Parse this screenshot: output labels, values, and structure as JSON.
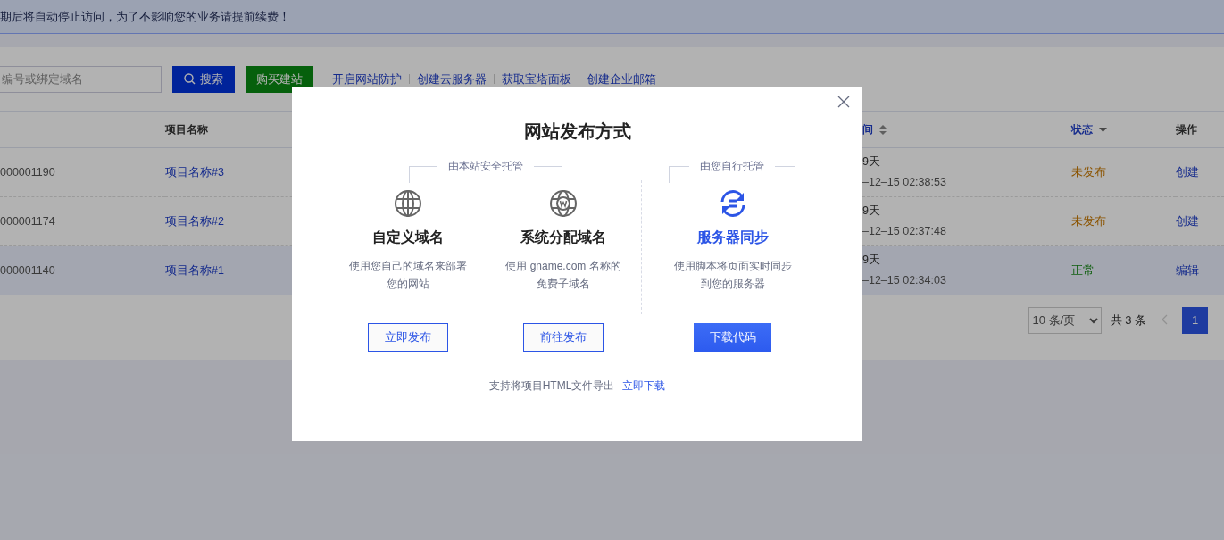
{
  "notice": "期后将自动停止访问，为了不影响您的业务请提前续费！",
  "toolbar": {
    "search": {
      "placeholder": "编号或绑定域名"
    },
    "search_button": "搜索",
    "buy_button": "购买建站",
    "links": [
      "开启网站防护",
      "创建云服务器",
      "获取宝塔面板",
      "创建企业邮箱"
    ]
  },
  "table": {
    "columns": [
      {
        "label": "项目名称",
        "kind": "plain"
      },
      {
        "label": "间",
        "kind": "sort"
      },
      {
        "label": "状态",
        "kind": "filter"
      },
      {
        "label": "操作",
        "kind": "plain"
      }
    ],
    "rows": [
      {
        "id": "000001190",
        "name": "项目名称#3",
        "days": "9天",
        "time": "–12–15 02:38:53",
        "status": "未发布",
        "kind": "pending",
        "action": "创建",
        "hovered": false
      },
      {
        "id": "000001174",
        "name": "项目名称#2",
        "days": "9天",
        "time": "–12–15 02:37:48",
        "status": "未发布",
        "kind": "pending",
        "action": "创建",
        "hovered": false
      },
      {
        "id": "000001140",
        "name": "项目名称#1",
        "days": "9天",
        "time": "–12–15 02:34:03",
        "status": "正常",
        "kind": "normal",
        "action": "编辑",
        "hovered": true
      }
    ]
  },
  "pagination": {
    "page_size": "10 条/页",
    "total": "共 3 条",
    "prev_disabled": true,
    "pages": [
      {
        "label": "1",
        "selected": true
      }
    ]
  },
  "modal": {
    "title": "网站发布方式",
    "groups": [
      {
        "label": "由本站安全托管"
      },
      {
        "label": "由您自行托管"
      }
    ],
    "options": [
      {
        "title": "自定义域名",
        "description": [
          "使用您自己的域名来部署",
          "您的网站"
        ],
        "button": "立即发布",
        "primary": false
      },
      {
        "title": "系统分配域名",
        "description": [
          "使用 gname.com 名称的",
          "免费子域名"
        ],
        "button": "前往发布",
        "primary": false
      },
      {
        "title": "服务器同步",
        "description": [
          "使用脚本将页面实时同步",
          "到您的服务器"
        ],
        "button": "下载代码",
        "primary": true
      }
    ],
    "footer_text": "支持将项目HTML文件导出",
    "footer_link": "立即下载"
  }
}
